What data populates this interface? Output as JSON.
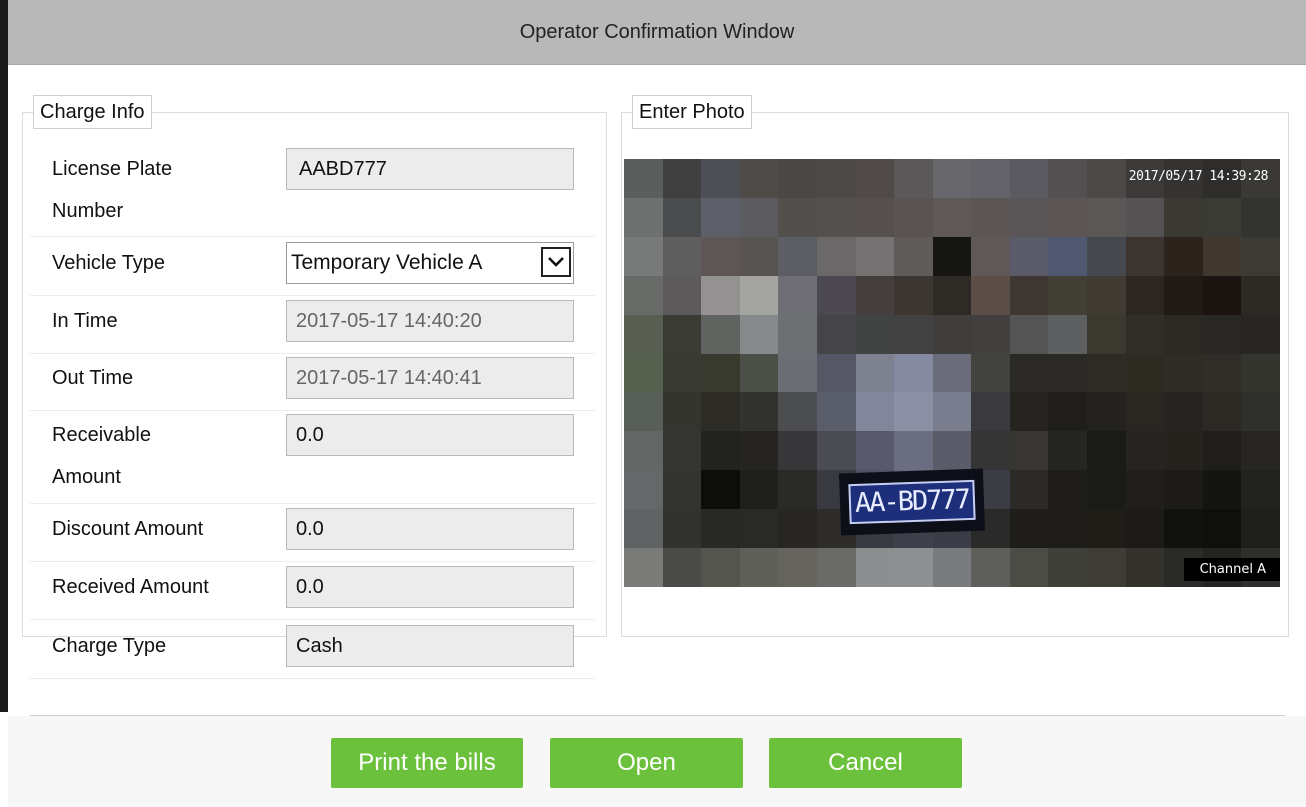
{
  "window": {
    "title": "Operator Confirmation Window"
  },
  "charge_info": {
    "legend": "Charge Info",
    "fields": {
      "license_plate": {
        "label_line1": "License Plate",
        "label_line2": "Number",
        "value": "AABD777"
      },
      "vehicle_type": {
        "label": "Vehicle Type",
        "value": "Temporary Vehicle A"
      },
      "in_time": {
        "label": "In Time",
        "value": "2017-05-17 14:40:20"
      },
      "out_time": {
        "label": "Out Time",
        "value": "2017-05-17 14:40:41"
      },
      "receivable_amount": {
        "label_line1": "Receivable",
        "label_line2": "Amount",
        "value": "0.0"
      },
      "discount_amount": {
        "label": "Discount Amount",
        "value": "0.0"
      },
      "received_amount": {
        "label": "Received Amount",
        "value": "0.0"
      },
      "charge_type": {
        "label": "Charge Type",
        "value": "Cash"
      }
    }
  },
  "enter_photo": {
    "legend": "Enter Photo",
    "timestamp": "2017/05/17  14:39:28",
    "plate_text": "AA-BD777",
    "channel_label": "Channel  A"
  },
  "actions": {
    "print": "Print the bills",
    "open": "Open",
    "cancel": "Cancel"
  },
  "colors": {
    "titlebar": "#b8b8b8",
    "button_green": "#6cc13c",
    "field_bg": "#ececec"
  },
  "icons": {
    "dropdown": "chevron-down-icon"
  }
}
